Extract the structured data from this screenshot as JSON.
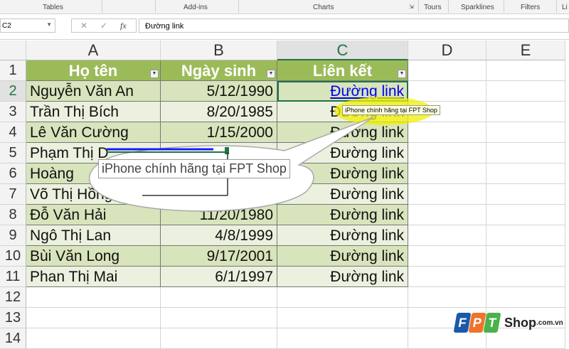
{
  "ribbon": {
    "groups": [
      "Tables",
      "Add-ins",
      "Charts",
      "Tours",
      "Sparklines",
      "Filters",
      "Li"
    ]
  },
  "formula_bar": {
    "name_box": "C2",
    "cancel_icon": "✕",
    "enter_icon": "✓",
    "fx": "fx",
    "value": "Đường link"
  },
  "columns": [
    "A",
    "B",
    "C",
    "D",
    "E"
  ],
  "rows": [
    "1",
    "2",
    "3",
    "4",
    "5",
    "6",
    "7",
    "8",
    "9",
    "10",
    "11",
    "12",
    "13",
    "14"
  ],
  "table": {
    "headers": [
      "Họ tên",
      "Ngày sinh",
      "Liên kết"
    ],
    "data": [
      [
        "Nguyễn Văn An",
        "5/12/1990",
        "Đường link"
      ],
      [
        "Trần Thị Bích",
        "8/20/1985",
        "Đường link"
      ],
      [
        "Lê Văn Cường",
        "1/15/2000",
        "Đường link"
      ],
      [
        "Phạm Thị D",
        "",
        "Đường link"
      ],
      [
        "Hoàng",
        "",
        "Đường link"
      ],
      [
        "Võ Thị Hồng",
        "",
        "Đường link"
      ],
      [
        "Đỗ Văn Hải",
        "11/20/1980",
        "Đường link"
      ],
      [
        "Ngô Thị Lan",
        "4/8/1999",
        "Đường link"
      ],
      [
        "Bùi Văn Long",
        "9/17/2001",
        "Đường link"
      ],
      [
        "Phan Thị Mai",
        "6/1/1997",
        "Đường link"
      ]
    ]
  },
  "screen_tip": "iPhone chính hãng tại FPT Shop",
  "zoomed_tip": "iPhone chính hãng tại FPT Shop",
  "logo": {
    "letters": [
      "F",
      "P",
      "T"
    ],
    "shop": "Shop",
    "domain": ".com.vn",
    "colors": [
      "#1a5aa8",
      "#f0732a",
      "#4bb249"
    ]
  }
}
